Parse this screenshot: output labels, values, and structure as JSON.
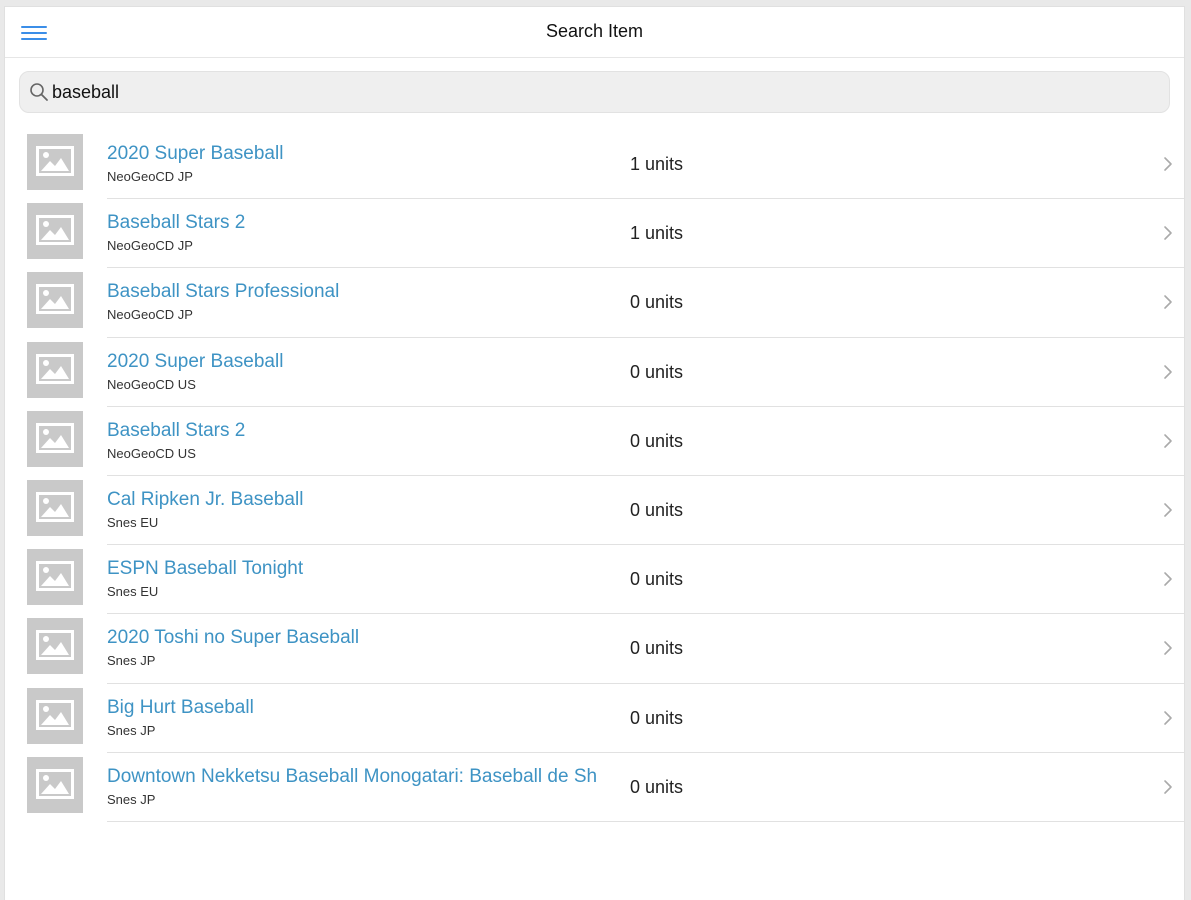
{
  "header": {
    "title": "Search Item",
    "menu_icon": "hamburger-menu-icon"
  },
  "search": {
    "value": "baseball",
    "icon": "search-icon"
  },
  "results": [
    {
      "name": "2020 Super Baseball",
      "platform": "NeoGeoCD JP",
      "units": "1 units"
    },
    {
      "name": "Baseball Stars 2",
      "platform": "NeoGeoCD JP",
      "units": "1 units"
    },
    {
      "name": "Baseball Stars Professional",
      "platform": "NeoGeoCD JP",
      "units": "0 units"
    },
    {
      "name": "2020 Super Baseball",
      "platform": "NeoGeoCD US",
      "units": "0 units"
    },
    {
      "name": "Baseball Stars 2",
      "platform": "NeoGeoCD US",
      "units": "0 units"
    },
    {
      "name": "Cal Ripken Jr. Baseball",
      "platform": "Snes EU",
      "units": "0 units"
    },
    {
      "name": "ESPN Baseball Tonight",
      "platform": "Snes EU",
      "units": "0 units"
    },
    {
      "name": "2020 Toshi no Super Baseball",
      "platform": "Snes JP",
      "units": "0 units"
    },
    {
      "name": "Big Hurt Baseball",
      "platform": "Snes JP",
      "units": "0 units"
    },
    {
      "name": "Downtown Nekketsu Baseball Monogatari: Baseball de Sh",
      "platform": "Snes JP",
      "units": "0 units"
    }
  ],
  "colors": {
    "accent": "#3b8ee8",
    "item_name": "#3e93c4",
    "thumb_placeholder": "#c9c9c9"
  }
}
